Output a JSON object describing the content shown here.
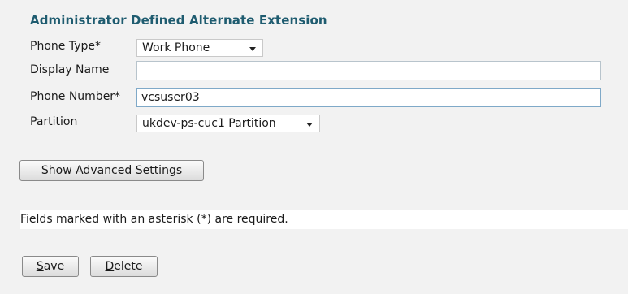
{
  "section": {
    "title": "Administrator Defined Alternate Extension"
  },
  "form": {
    "phone_type": {
      "label": "Phone Type*",
      "value": "Work Phone"
    },
    "display_name": {
      "label": "Display Name",
      "value": ""
    },
    "phone_number": {
      "label": "Phone Number*",
      "value": "vcsuser03"
    },
    "partition": {
      "label": "Partition",
      "value": "ukdev-ps-cuc1 Partition"
    }
  },
  "buttons": {
    "advanced": "Show Advanced Settings",
    "save_first": "S",
    "save_rest": "ave",
    "delete_first": "D",
    "delete_rest": "elete"
  },
  "note": "Fields marked with an asterisk (*) are required."
}
